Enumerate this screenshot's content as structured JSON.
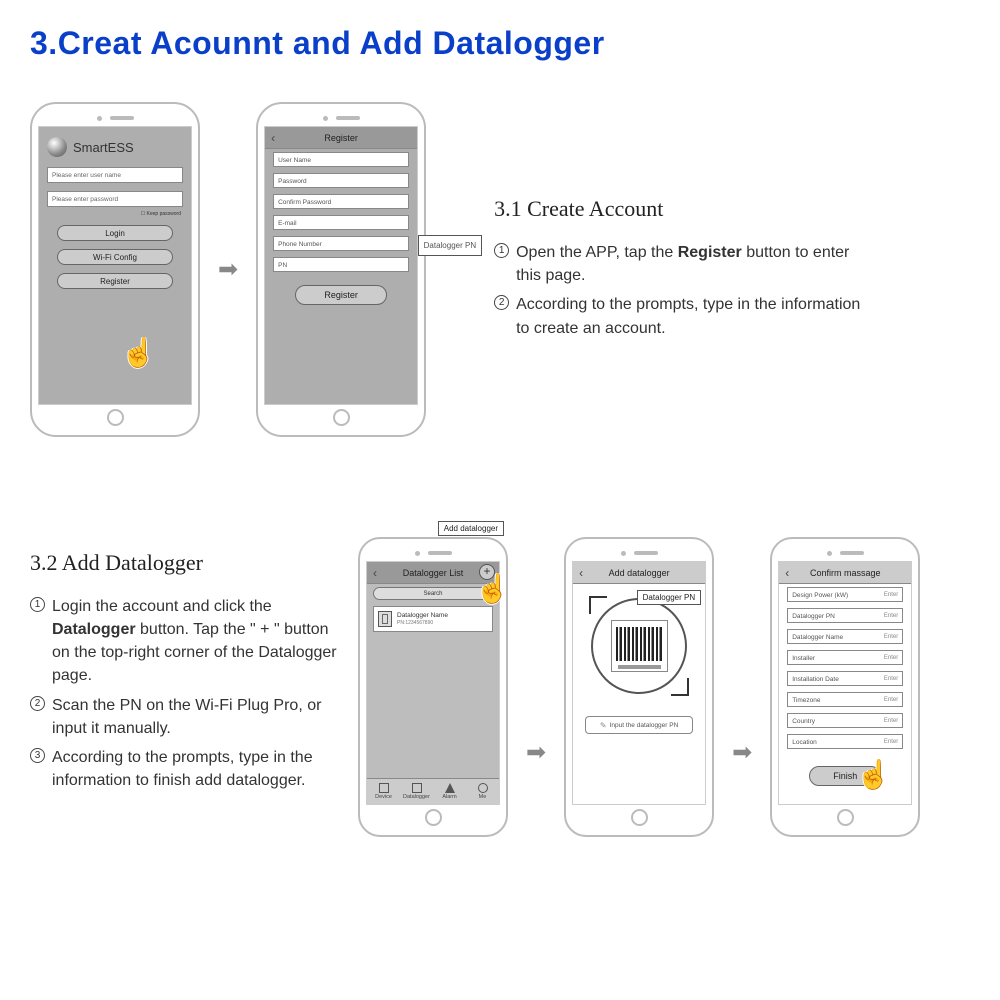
{
  "title": "3.Creat Acounnt and Add Datalogger",
  "section1": {
    "title": "3.1 Create Account",
    "steps": [
      "Open the APP, tap the <b>Register</b> button to enter this page.",
      "According to the prompts, type in the information to create an account."
    ]
  },
  "section2": {
    "title": "3.2 Add Datalogger",
    "steps": [
      "Login the account and click the <b>Datalogger</b> button. Tap the \" + \" button on the top-right corner of the Datalogger page.",
      "Scan the PN on the Wi-Fi Plug Pro, or input it manually.",
      "According to the prompts, type in the information to finish add datalogger."
    ]
  },
  "phone1": {
    "brand": "SmartESS",
    "user_ph": "Please enter user name",
    "pass_ph": "Please enter password",
    "keep": "Keep password",
    "login": "Login",
    "wifi": "Wi-Fi Config",
    "register": "Register"
  },
  "phone2": {
    "header": "Register",
    "fields": [
      "User Name",
      "Password",
      "Confirm Password",
      "E-mail",
      "Phone Number",
      "PN"
    ],
    "tooltip": "Datalogger PN",
    "submit": "Register"
  },
  "phone3": {
    "header": "Datalogger List",
    "tooltip": "Add datalogger",
    "search": "Search",
    "item_title": "Datalogger Name",
    "item_sub": "PN:1234567890",
    "tabs": [
      "Device",
      "Datalogger",
      "Alarm",
      "Me"
    ]
  },
  "phone4": {
    "header": "Add datalogger",
    "tooltip": "Datalogger PN",
    "input": "Input the datalogger PN"
  },
  "phone5": {
    "header": "Confirm massage",
    "rows": [
      "Design Power (kW)",
      "Datalogger PN",
      "Datalogger Name",
      "Installer",
      "Installation Date",
      "Timezone",
      "Country",
      "Location"
    ],
    "enter": "Enter",
    "finish": "Finish"
  }
}
